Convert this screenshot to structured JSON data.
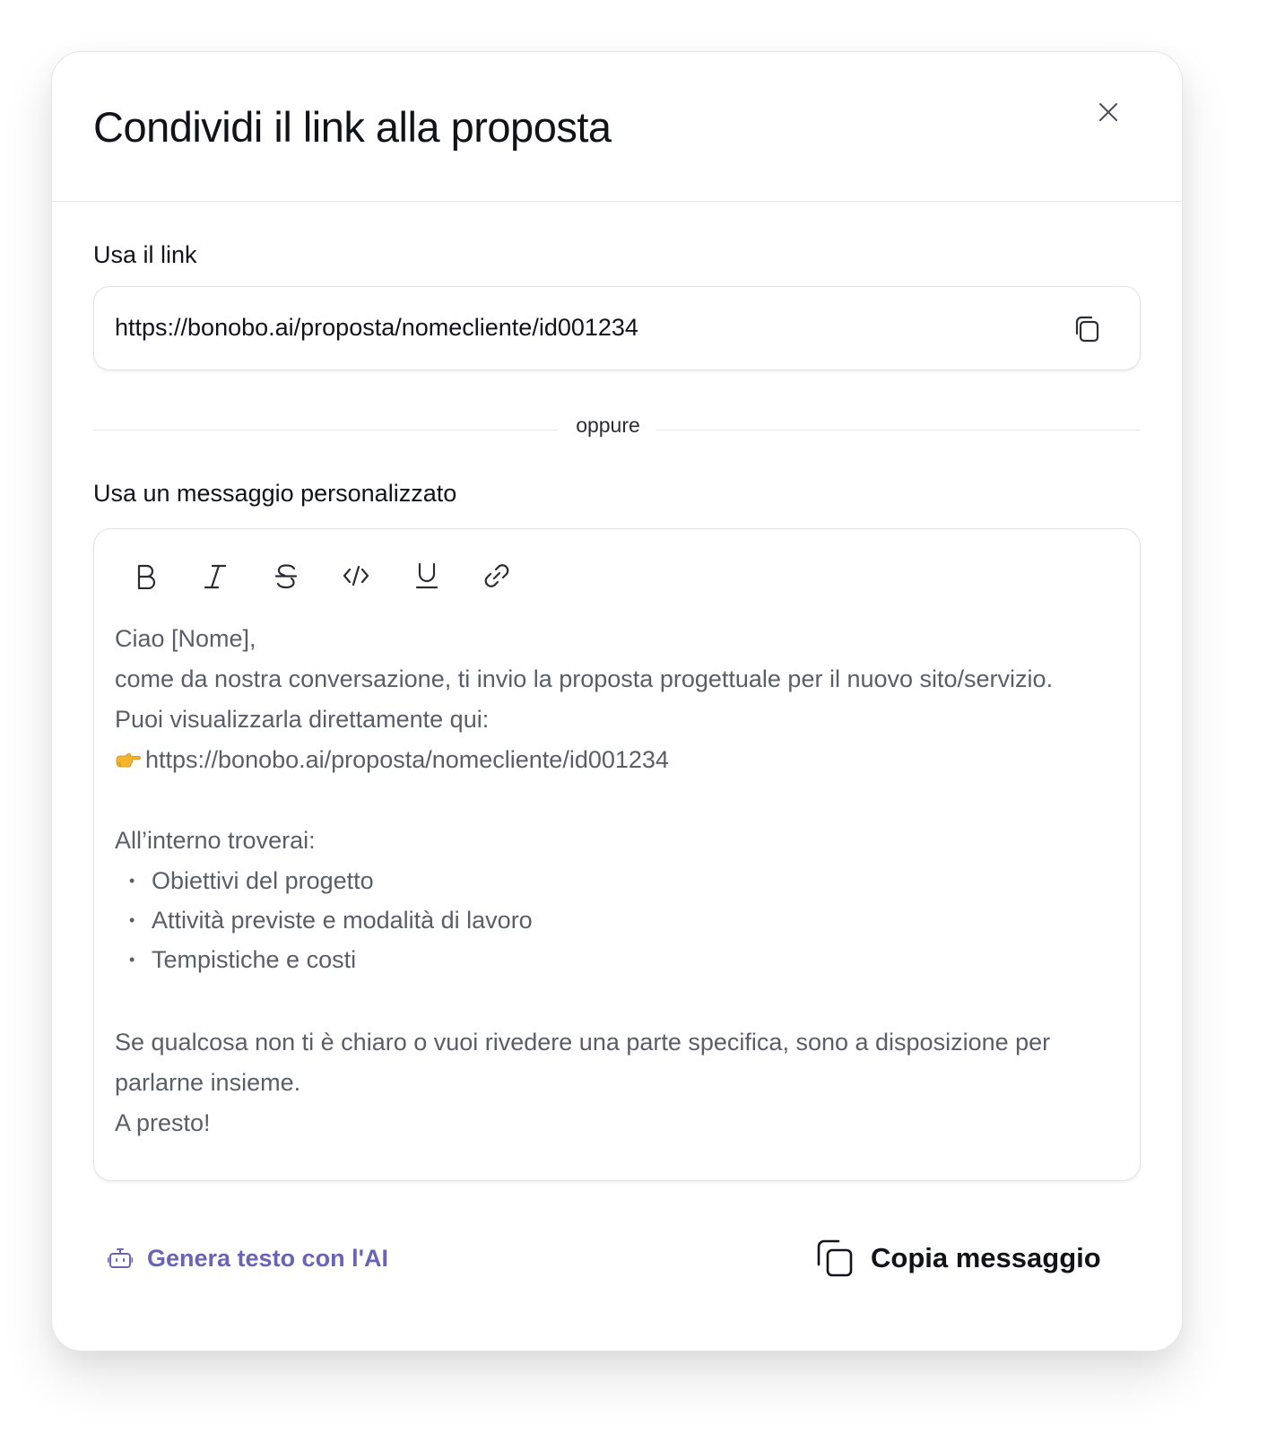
{
  "modal": {
    "title": "Condividi il link alla proposta",
    "close_icon": "close-icon"
  },
  "link_section": {
    "label": "Usa il link",
    "url": "https://bonobo.ai/proposta/nomecliente/id001234",
    "copy_icon": "copy-icon"
  },
  "divider": {
    "text": "oppure"
  },
  "message_section": {
    "label": "Usa un messaggio personalizzato",
    "toolbar": [
      {
        "name": "bold",
        "icon": "bold-icon"
      },
      {
        "name": "italic",
        "icon": "italic-icon"
      },
      {
        "name": "strikethrough",
        "icon": "strikethrough-icon"
      },
      {
        "name": "code",
        "icon": "code-icon"
      },
      {
        "name": "underline",
        "icon": "underline-icon"
      },
      {
        "name": "link",
        "icon": "link-icon"
      }
    ],
    "content": {
      "greeting": "Ciao [Nome],",
      "line1": "come da nostra conversazione, ti invio la proposta progettuale per il nuovo sito/servizio.",
      "line2": "Puoi visualizzarla direttamente qui:",
      "link_emoji": "pointing-hand-icon",
      "link": "https://bonobo.ai/proposta/nomecliente/id001234",
      "list_intro": "All’interno troverai:",
      "list_items": [
        "Obiettivi del progetto",
        "Attività previste e modalità di lavoro",
        "Tempistiche e costi"
      ],
      "closing_para": "Se qualcosa non ti è chiaro o vuoi rivedere una parte specifica, sono a disposizione per parlarne insieme.",
      "signoff": "A presto!"
    }
  },
  "footer": {
    "ai_button_label": "Genera testo con l'AI",
    "ai_icon": "robot-icon",
    "copy_button_label": "Copia messaggio",
    "copy_icon": "copy-icon"
  },
  "colors": {
    "accent": "#6a64b5",
    "text_primary": "#111318",
    "text_muted": "#5c5e66",
    "border": "#e1e2e6"
  }
}
